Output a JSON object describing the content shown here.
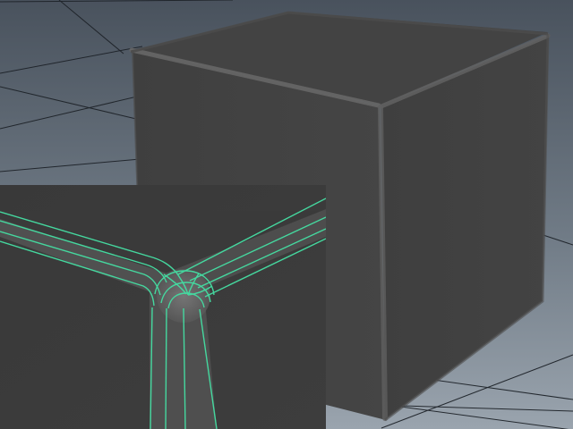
{
  "viewport": {
    "background_top": "#4c5560",
    "background_bottom": "#8d98a3",
    "grid_color": "#1b1f24",
    "shape": "beveled-cube"
  },
  "mesh": {
    "face_color": "#3f3f3f",
    "edge_highlight": "#636363",
    "wireframe_color": "#46d6a0"
  }
}
